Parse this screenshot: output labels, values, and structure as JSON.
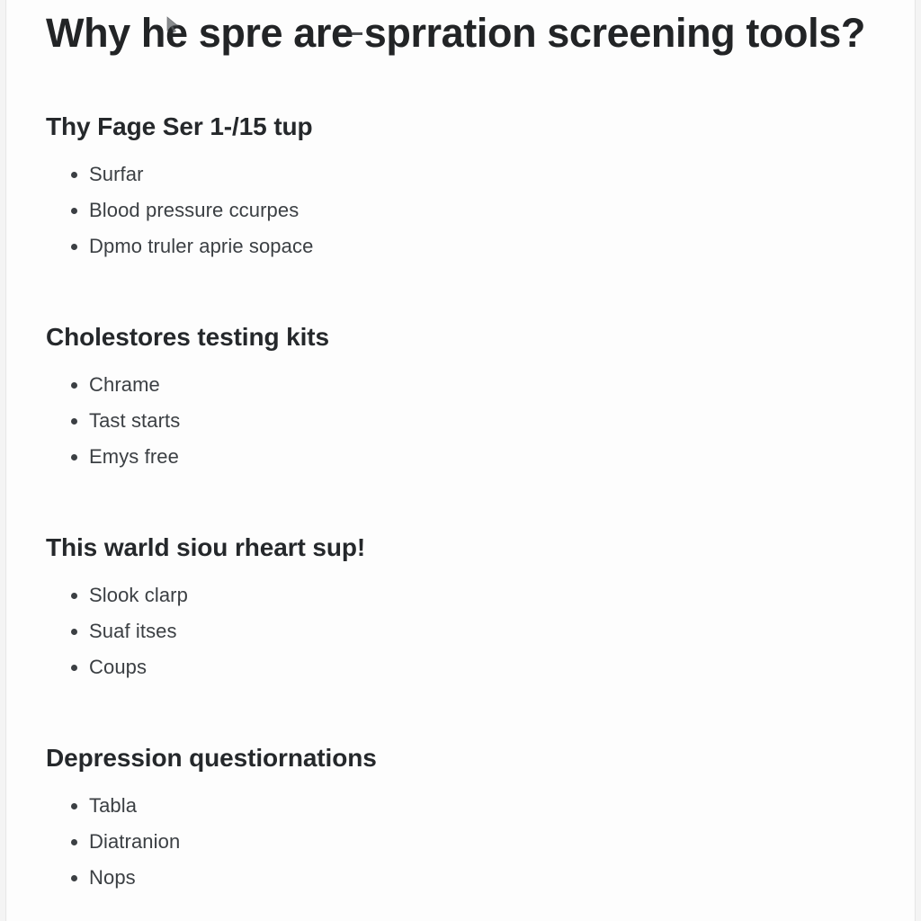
{
  "document": {
    "title": "Why he spre are sprration screening tools?",
    "background_color": "#fdfdfd",
    "text_color": "#3b3f43",
    "heading_color": "#25282b"
  },
  "sections": [
    {
      "heading": "Thy Fage Ser 1-/15 tup",
      "items": [
        "Surfar",
        "Blood pressure ccurpes",
        "Dpmo truler aprie sopace"
      ]
    },
    {
      "heading": "Cholestores testing kits",
      "items": [
        "Chrame",
        "Tast starts",
        "Emys free"
      ]
    },
    {
      "heading": "This warld siou rheart sup!",
      "items": [
        "Slook clarp",
        "Suaf itses",
        "Coups"
      ]
    },
    {
      "heading": "Depression questiornations",
      "items": [
        "Tabla",
        "Diatranion",
        "Nops"
      ]
    }
  ],
  "artifacts": {
    "cursor_icon": "mouse-pointer-icon",
    "strike_mark": "horizontal-stroke-artifact"
  }
}
